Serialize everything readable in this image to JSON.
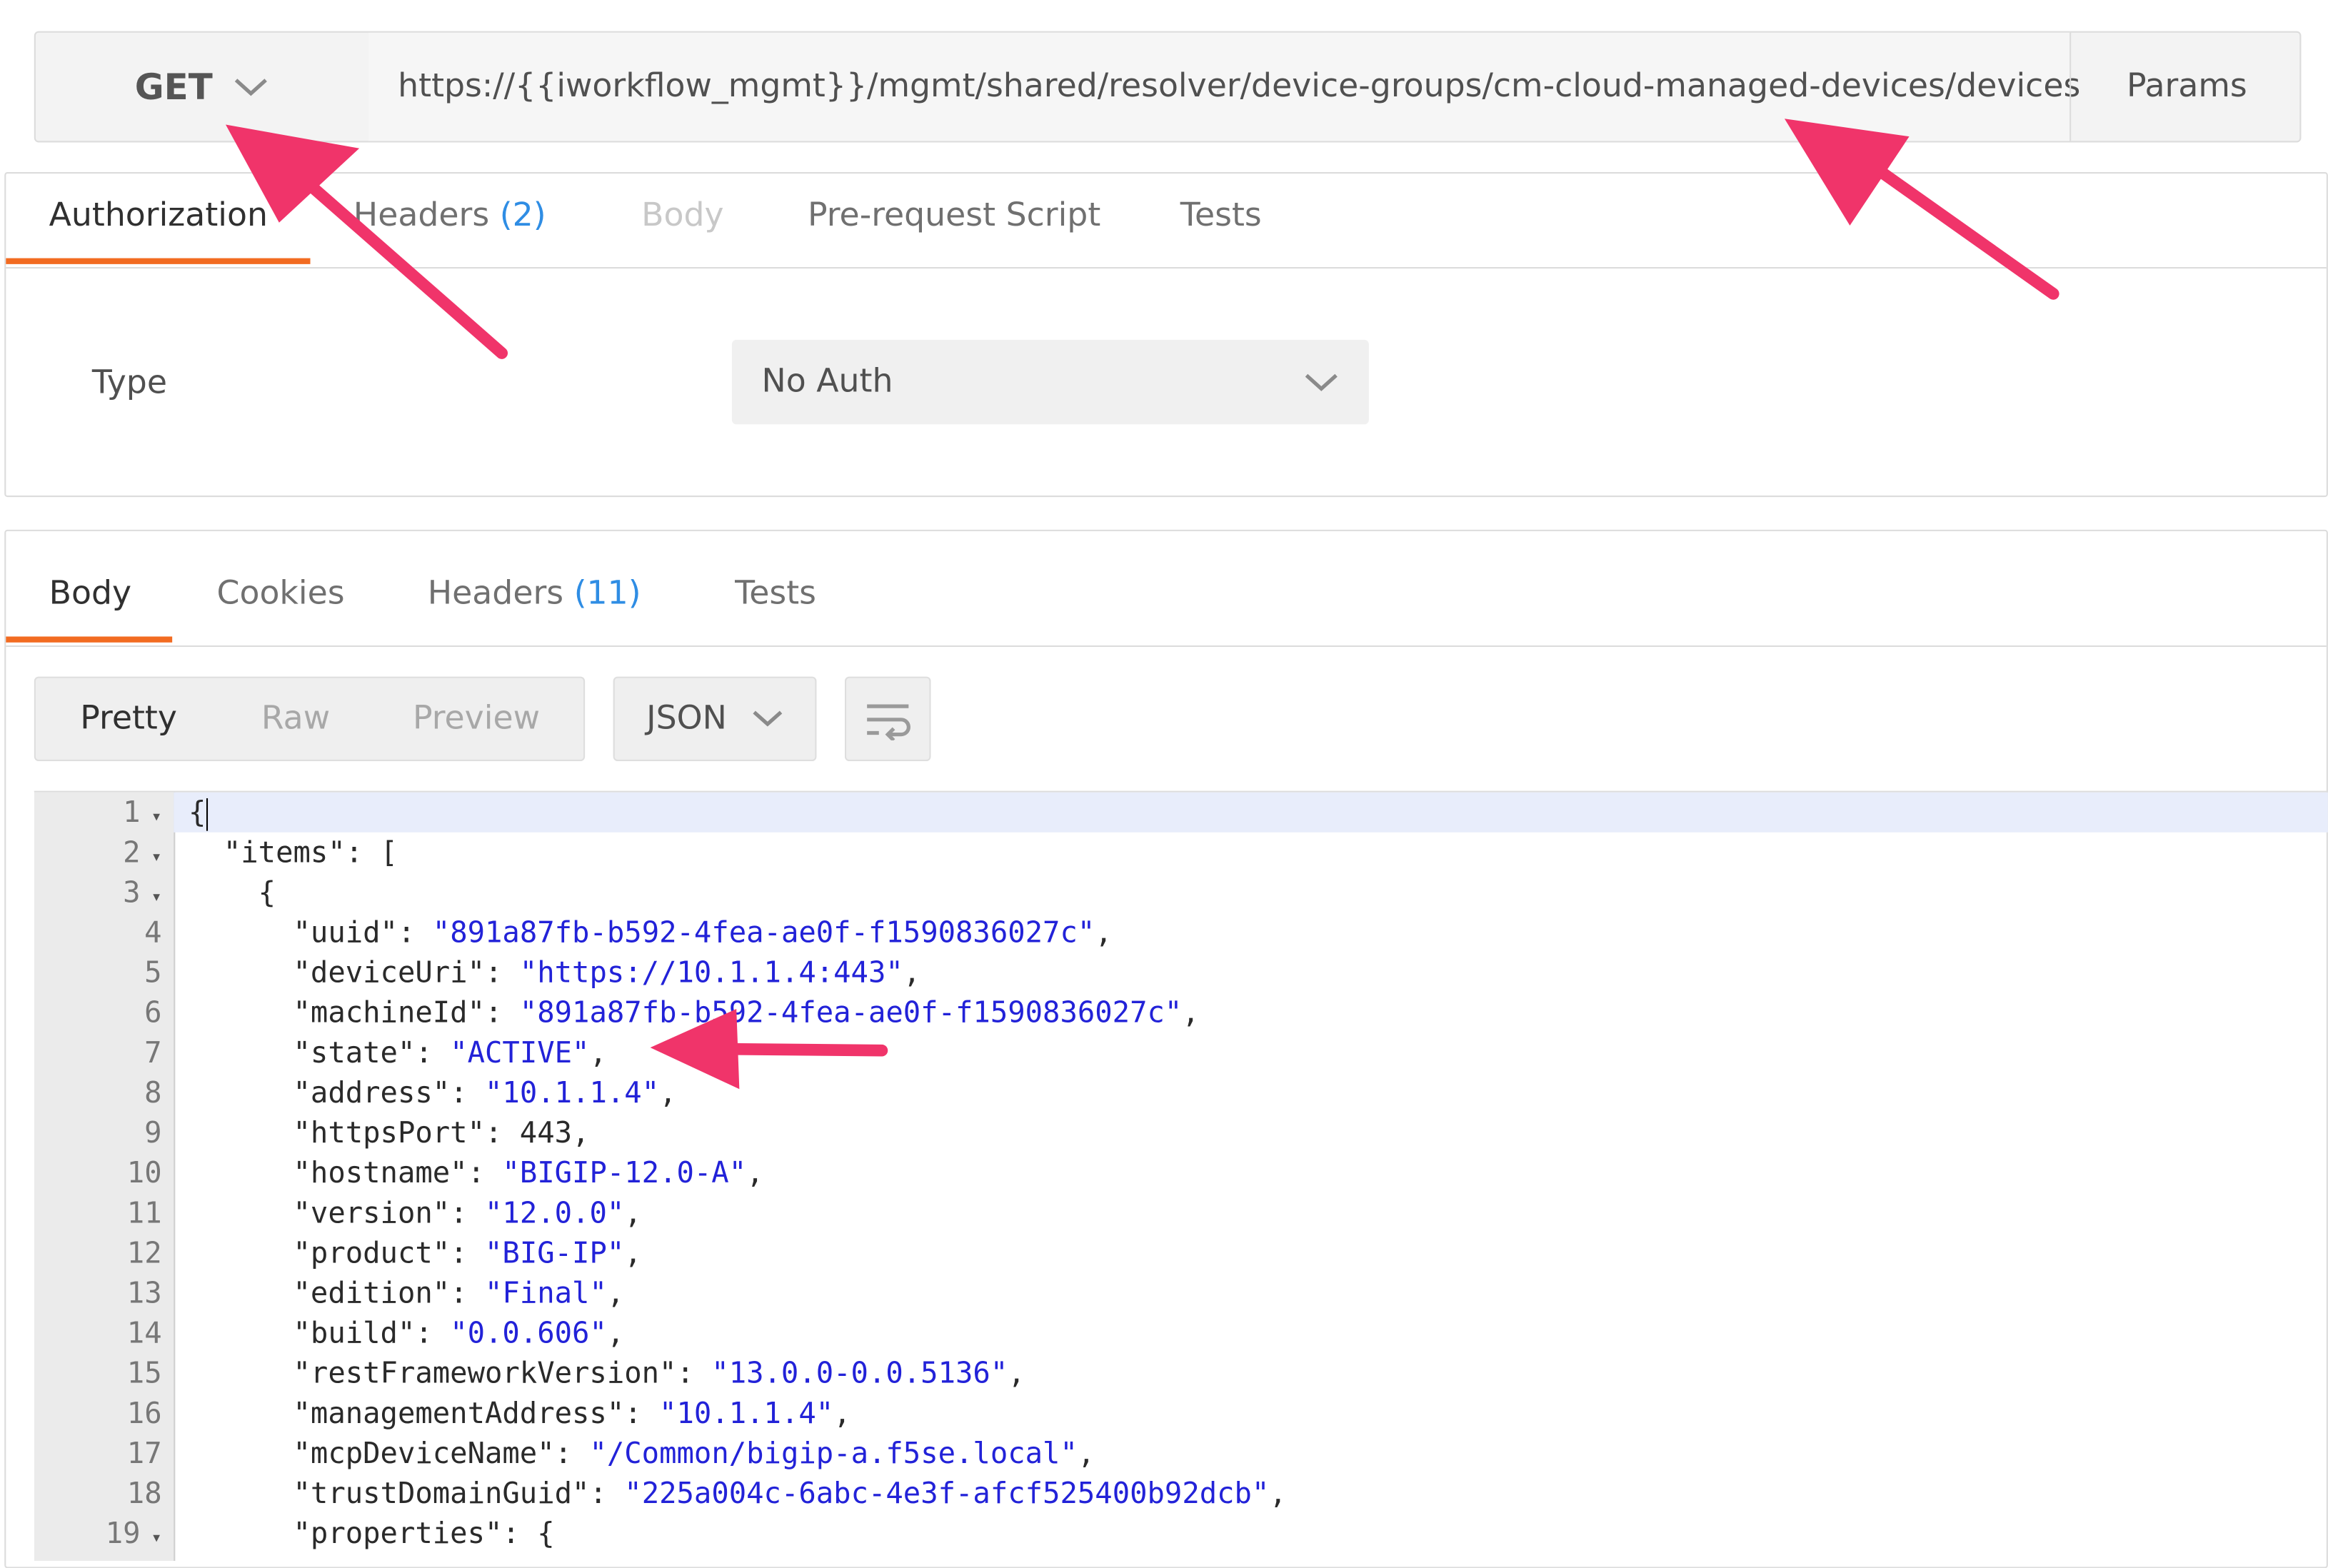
{
  "request": {
    "method": "GET",
    "url": "https://{{iworkflow_mgmt}}/mgmt/shared/resolver/device-groups/cm-cloud-managed-devices/devices",
    "params_label": "Params",
    "tabs": [
      {
        "label": "Authorization"
      },
      {
        "label": "Headers",
        "count": "(2)"
      },
      {
        "label": "Body"
      },
      {
        "label": "Pre-request Script"
      },
      {
        "label": "Tests"
      }
    ],
    "auth": {
      "type_label": "Type",
      "selected": "No Auth"
    }
  },
  "response": {
    "tabs": [
      {
        "label": "Body"
      },
      {
        "label": "Cookies"
      },
      {
        "label": "Headers",
        "count": "(11)"
      },
      {
        "label": "Tests"
      }
    ],
    "view_modes": [
      "Pretty",
      "Raw",
      "Preview"
    ],
    "format": "JSON",
    "wrap_icon": "wrap-lines-icon"
  },
  "code_lines": [
    {
      "n": "1",
      "fold": true,
      "text": "{"
    },
    {
      "n": "2",
      "fold": true,
      "key": "\"items\"",
      "rest": ": ["
    },
    {
      "n": "3",
      "fold": true,
      "text": "    {"
    },
    {
      "n": "4",
      "key": "\"uuid\"",
      "val": "\"891a87fb-b592-4fea-ae0f-f1590836027c\"",
      "end": ","
    },
    {
      "n": "5",
      "key": "\"deviceUri\"",
      "val": "\"https://10.1.1.4:443\"",
      "end": ","
    },
    {
      "n": "6",
      "key": "\"machineId\"",
      "val": "\"891a87fb-b592-4fea-ae0f-f1590836027c\"",
      "end": ","
    },
    {
      "n": "7",
      "key": "\"state\"",
      "val": "\"ACTIVE\"",
      "end": ","
    },
    {
      "n": "8",
      "key": "\"address\"",
      "val": "\"10.1.1.4\"",
      "end": ","
    },
    {
      "n": "9",
      "key": "\"httpsPort\"",
      "num": "443",
      "end": ","
    },
    {
      "n": "10",
      "key": "\"hostname\"",
      "val": "\"BIGIP-12.0-A\"",
      "end": ","
    },
    {
      "n": "11",
      "key": "\"version\"",
      "val": "\"12.0.0\"",
      "end": ","
    },
    {
      "n": "12",
      "key": "\"product\"",
      "val": "\"BIG-IP\"",
      "end": ","
    },
    {
      "n": "13",
      "key": "\"edition\"",
      "val": "\"Final\"",
      "end": ","
    },
    {
      "n": "14",
      "key": "\"build\"",
      "val": "\"0.0.606\"",
      "end": ","
    },
    {
      "n": "15",
      "key": "\"restFrameworkVersion\"",
      "val": "\"13.0.0-0.0.5136\"",
      "end": ","
    },
    {
      "n": "16",
      "key": "\"managementAddress\"",
      "val": "\"10.1.1.4\"",
      "end": ","
    },
    {
      "n": "17",
      "key": "\"mcpDeviceName\"",
      "val": "\"/Common/bigip-a.f5se.local\"",
      "end": ","
    },
    {
      "n": "18",
      "key": "\"trustDomainGuid\"",
      "val": "\"225a004c-6abc-4e3f-afcf525400b92dcb\"",
      "end": ","
    },
    {
      "n": "19",
      "fold": true,
      "key": "\"properties\"",
      "rest": ": {"
    }
  ],
  "colors": {
    "accent": "#f26b21",
    "annotation_arrow": "#f0346a",
    "json_string": "#2222d8",
    "count_blue": "#2f8de4"
  }
}
